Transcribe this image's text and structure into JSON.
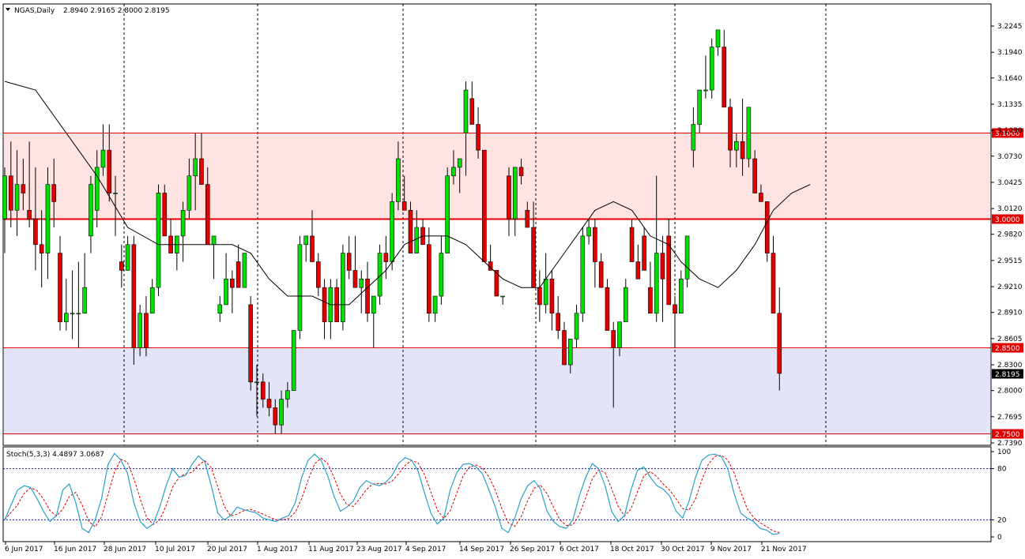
{
  "header": {
    "symbol_text": "NGAS,Daily",
    "ohlc_text": "2.8940 2.9165 2.8000 2.8195"
  },
  "stoch_header": {
    "text": "Stoch(5,3,3) 4.4897 3.0687"
  },
  "colors": {
    "bull": "#00e000",
    "bear": "#e00000",
    "resistance_zone": "#ffe3e3",
    "support_zone": "#e4e4f8",
    "level_line": "#e00000",
    "ma_line": "#000000",
    "stoch_main": "#2aa0c8",
    "stoch_signal": "#e00000",
    "level_marker": "#1010c0"
  },
  "chart_data": {
    "type": "candlestick",
    "y_range": [
      2.739,
      3.2245
    ],
    "price_axis_ticks": [
      "3.2245",
      "3.1940",
      "3.1640",
      "3.1335",
      "3.1030",
      "3.0730",
      "3.0425",
      "3.0120",
      "2.9820",
      "2.9515",
      "2.9210",
      "2.8910",
      "2.8605",
      "2.8300",
      "2.8000",
      "2.7695",
      "2.7390"
    ],
    "x_labels": [
      "6 Jun 2017",
      "16 Jun 2017",
      "28 Jun 2017",
      "10 Jul 2017",
      "20 Jul 2017",
      "1 Aug 2017",
      "11 Aug 2017",
      "23 Aug 2017",
      "4 Sep 2017",
      "14 Sep 2017",
      "26 Sep 2017",
      "6 Oct 2017",
      "18 Oct 2017",
      "30 Oct 2017",
      "9 Nov 2017",
      "21 Nov 2017"
    ],
    "horizontal_levels": [
      {
        "label": "3.1000",
        "value": 3.1
      },
      {
        "label": "3.0000",
        "value": 3.0
      },
      {
        "label": "2.8500",
        "value": 2.85
      },
      {
        "label": "2.7500",
        "value": 2.75
      }
    ],
    "current_price": {
      "label": "2.8195",
      "value": 2.8195
    },
    "zones": [
      {
        "name": "resistance",
        "from": 3.0,
        "to": 3.1
      },
      {
        "name": "support",
        "from": 2.75,
        "to": 2.85
      }
    ],
    "candles": [
      [
        3.0,
        3.06,
        2.96,
        3.05
      ],
      [
        3.05,
        3.09,
        2.99,
        3.01
      ],
      [
        3.01,
        3.08,
        2.98,
        3.04
      ],
      [
        3.04,
        3.07,
        3.01,
        3.03
      ],
      [
        3.01,
        3.09,
        2.99,
        3.0
      ],
      [
        3.0,
        3.06,
        2.94,
        2.97
      ],
      [
        2.97,
        3.01,
        2.92,
        2.96
      ],
      [
        2.96,
        3.06,
        2.93,
        3.04
      ],
      [
        3.04,
        3.07,
        2.99,
        3.02
      ],
      [
        2.96,
        2.98,
        2.87,
        2.88
      ],
      [
        2.88,
        2.93,
        2.87,
        2.89
      ],
      [
        2.89,
        2.94,
        2.86,
        2.89
      ],
      [
        2.89,
        2.95,
        2.85,
        2.89
      ],
      [
        2.89,
        2.96,
        2.89,
        2.92
      ],
      [
        2.98,
        3.05,
        2.96,
        3.04
      ],
      [
        3.01,
        3.08,
        2.99,
        3.06
      ],
      [
        3.06,
        3.11,
        3.05,
        3.08
      ],
      [
        3.08,
        3.11,
        3.02,
        3.03
      ],
      [
        3.03,
        3.05,
        2.98,
        3.03
      ],
      [
        2.95,
        2.97,
        2.92,
        2.94
      ],
      [
        2.94,
        2.98,
        2.94,
        2.97
      ],
      [
        2.97,
        2.98,
        2.83,
        2.85
      ],
      [
        2.85,
        2.9,
        2.84,
        2.89
      ],
      [
        2.89,
        2.91,
        2.84,
        2.85
      ],
      [
        2.89,
        2.93,
        2.89,
        2.92
      ],
      [
        2.92,
        3.04,
        2.91,
        3.03
      ],
      [
        3.03,
        3.04,
        2.98,
        2.98
      ],
      [
        2.98,
        3.0,
        2.97,
        2.96
      ],
      [
        2.96,
        2.98,
        2.94,
        2.98
      ],
      [
        2.98,
        3.02,
        2.95,
        3.01
      ],
      [
        3.01,
        3.07,
        3.0,
        3.05
      ],
      [
        3.05,
        3.1,
        3.01,
        3.07
      ],
      [
        3.07,
        3.1,
        3.04,
        3.04
      ],
      [
        3.04,
        3.06,
        2.97,
        2.97
      ],
      [
        2.97,
        2.98,
        2.93,
        2.98
      ],
      [
        2.89,
        2.91,
        2.88,
        2.9
      ],
      [
        2.9,
        2.96,
        2.9,
        2.93
      ],
      [
        2.93,
        2.94,
        2.89,
        2.92
      ],
      [
        2.95,
        2.97,
        2.92,
        2.92
      ],
      [
        2.92,
        2.96,
        2.92,
        2.96
      ],
      [
        2.9,
        2.91,
        2.8,
        2.81
      ],
      [
        2.81,
        2.83,
        2.77,
        2.81
      ],
      [
        2.81,
        2.82,
        2.78,
        2.79
      ],
      [
        2.79,
        2.81,
        2.77,
        2.78
      ],
      [
        2.78,
        2.79,
        2.75,
        2.76
      ],
      [
        2.76,
        2.8,
        2.75,
        2.79
      ],
      [
        2.79,
        2.81,
        2.78,
        2.8
      ],
      [
        2.8,
        2.84,
        2.8,
        2.87
      ],
      [
        2.87,
        2.98,
        2.86,
        2.97
      ],
      [
        2.97,
        2.98,
        2.95,
        2.98
      ],
      [
        2.98,
        3.01,
        2.95,
        2.95
      ],
      [
        2.95,
        2.96,
        2.91,
        2.92
      ],
      [
        2.92,
        2.93,
        2.86,
        2.88
      ],
      [
        2.88,
        2.93,
        2.86,
        2.92
      ],
      [
        2.92,
        2.93,
        2.88,
        2.88
      ],
      [
        2.88,
        2.97,
        2.87,
        2.96
      ],
      [
        2.96,
        2.98,
        2.93,
        2.94
      ],
      [
        2.94,
        2.98,
        2.92,
        2.92
      ],
      [
        2.92,
        2.94,
        2.89,
        2.93
      ],
      [
        2.93,
        2.95,
        2.88,
        2.89
      ],
      [
        2.89,
        2.91,
        2.85,
        2.91
      ],
      [
        2.91,
        2.97,
        2.9,
        2.96
      ],
      [
        2.96,
        2.98,
        2.93,
        2.95
      ],
      [
        2.95,
        3.03,
        2.94,
        3.02
      ],
      [
        3.02,
        3.09,
        3.01,
        3.07
      ],
      [
        3.02,
        3.05,
        3.01,
        3.01
      ],
      [
        3.01,
        3.02,
        2.96,
        2.96
      ],
      [
        2.96,
        3.01,
        2.96,
        2.99
      ],
      [
        2.99,
        3.0,
        2.97,
        2.97
      ],
      [
        2.97,
        2.99,
        2.88,
        2.89
      ],
      [
        2.89,
        2.91,
        2.88,
        2.91
      ],
      [
        2.91,
        2.98,
        2.9,
        2.96
      ],
      [
        2.96,
        3.06,
        2.96,
        3.05
      ],
      [
        3.05,
        3.08,
        3.04,
        3.06
      ],
      [
        3.06,
        3.07,
        3.03,
        3.07
      ],
      [
        3.1,
        3.16,
        3.05,
        3.15
      ],
      [
        3.14,
        3.16,
        3.11,
        3.11
      ],
      [
        3.11,
        3.13,
        3.07,
        3.08
      ],
      [
        3.08,
        3.08,
        2.95,
        2.95
      ],
      [
        2.95,
        2.97,
        2.94,
        2.94
      ],
      [
        2.94,
        2.94,
        2.91,
        2.91
      ],
      [
        2.91,
        2.91,
        2.9,
        2.91
      ],
      [
        3.05,
        3.06,
        2.98,
        3.0
      ],
      [
        3.0,
        3.06,
        2.98,
        3.06
      ],
      [
        3.06,
        3.07,
        3.04,
        3.05
      ],
      [
        3.01,
        3.02,
        2.99,
        2.99
      ],
      [
        2.99,
        3.02,
        2.96,
        2.92
      ],
      [
        2.92,
        2.94,
        2.88,
        2.9
      ],
      [
        2.9,
        2.96,
        2.89,
        2.93
      ],
      [
        2.93,
        2.94,
        2.87,
        2.89
      ],
      [
        2.89,
        2.91,
        2.86,
        2.87
      ],
      [
        2.87,
        2.88,
        2.84,
        2.83
      ],
      [
        2.83,
        2.85,
        2.82,
        2.86
      ],
      [
        2.86,
        2.9,
        2.85,
        2.89
      ],
      [
        2.89,
        2.99,
        2.88,
        2.98
      ],
      [
        2.98,
        3.0,
        2.97,
        2.99
      ],
      [
        2.99,
        3.0,
        2.92,
        2.95
      ],
      [
        2.95,
        2.96,
        2.92,
        2.92
      ],
      [
        2.92,
        2.93,
        2.87,
        2.87
      ],
      [
        2.87,
        2.88,
        2.78,
        2.85
      ],
      [
        2.85,
        2.88,
        2.84,
        2.88
      ],
      [
        2.88,
        2.93,
        2.88,
        2.92
      ],
      [
        2.99,
        3.0,
        2.95,
        2.95
      ],
      [
        2.95,
        2.97,
        2.93,
        2.93
      ],
      [
        2.98,
        2.99,
        2.94,
        2.94
      ],
      [
        2.92,
        2.95,
        2.89,
        2.89
      ],
      [
        2.89,
        3.05,
        2.88,
        2.96
      ],
      [
        2.96,
        2.98,
        2.88,
        2.93
      ],
      [
        2.98,
        3.0,
        2.9,
        2.9
      ],
      [
        2.9,
        2.91,
        2.85,
        2.89
      ],
      [
        2.89,
        2.94,
        2.89,
        2.93
      ],
      [
        2.93,
        2.98,
        2.92,
        2.98
      ],
      [
        3.08,
        3.13,
        3.06,
        3.11
      ],
      [
        3.11,
        3.14,
        3.1,
        3.15
      ],
      [
        3.15,
        3.19,
        3.14,
        3.15
      ],
      [
        3.15,
        3.21,
        3.14,
        3.2
      ],
      [
        3.2,
        3.22,
        3.19,
        3.22
      ],
      [
        3.2,
        3.22,
        3.13,
        3.13
      ],
      [
        3.13,
        3.14,
        3.06,
        3.08
      ],
      [
        3.08,
        3.1,
        3.06,
        3.09
      ],
      [
        3.09,
        3.14,
        3.05,
        3.07
      ],
      [
        3.07,
        3.13,
        3.06,
        3.13
      ],
      [
        3.07,
        3.08,
        3.03,
        3.03
      ],
      [
        3.03,
        3.04,
        3.02,
        3.02
      ],
      [
        3.02,
        3.02,
        2.95,
        2.96
      ],
      [
        2.96,
        2.98,
        2.89,
        2.89
      ],
      [
        2.89,
        2.92,
        2.8,
        2.82
      ]
    ],
    "moving_average": [
      [
        0,
        3.16
      ],
      [
        5,
        3.15
      ],
      [
        10,
        3.1
      ],
      [
        15,
        3.05
      ],
      [
        20,
        2.99
      ],
      [
        25,
        2.97
      ],
      [
        30,
        2.97
      ],
      [
        33,
        2.97
      ],
      [
        37,
        2.97
      ],
      [
        40,
        2.96
      ],
      [
        43,
        2.93
      ],
      [
        46,
        2.91
      ],
      [
        50,
        2.91
      ],
      [
        53,
        2.9
      ],
      [
        56,
        2.9
      ],
      [
        59,
        2.92
      ],
      [
        62,
        2.94
      ],
      [
        65,
        2.97
      ],
      [
        68,
        2.98
      ],
      [
        72,
        2.98
      ],
      [
        75,
        2.97
      ],
      [
        78,
        2.95
      ],
      [
        81,
        2.93
      ],
      [
        84,
        2.92
      ],
      [
        87,
        2.92
      ],
      [
        90,
        2.95
      ],
      [
        93,
        2.98
      ],
      [
        96,
        3.01
      ],
      [
        99,
        3.02
      ],
      [
        102,
        3.01
      ],
      [
        105,
        2.98
      ],
      [
        108,
        2.97
      ],
      [
        110,
        2.95
      ],
      [
        113,
        2.93
      ],
      [
        116,
        2.92
      ],
      [
        119,
        2.94
      ],
      [
        122,
        2.97
      ],
      [
        125,
        3.01
      ],
      [
        128,
        3.03
      ],
      [
        131,
        3.04
      ]
    ],
    "stochastic": {
      "levels": [
        80,
        20
      ],
      "axis_ticks": [
        "100",
        "80",
        "20",
        "0"
      ],
      "main": [
        20,
        38,
        55,
        60,
        58,
        45,
        30,
        18,
        25,
        55,
        62,
        40,
        10,
        5,
        20,
        45,
        85,
        98,
        90,
        75,
        40,
        18,
        10,
        15,
        35,
        60,
        80,
        70,
        72,
        85,
        95,
        88,
        60,
        28,
        20,
        25,
        35,
        32,
        30,
        28,
        22,
        20,
        18,
        22,
        25,
        40,
        70,
        90,
        97,
        90,
        72,
        48,
        30,
        35,
        42,
        58,
        66,
        62,
        60,
        64,
        72,
        86,
        93,
        90,
        78,
        52,
        28,
        15,
        22,
        55,
        75,
        85,
        86,
        82,
        74,
        55,
        35,
        10,
        5,
        22,
        45,
        60,
        66,
        56,
        30,
        18,
        12,
        10,
        20,
        48,
        70,
        86,
        80,
        60,
        30,
        18,
        25,
        55,
        78,
        82,
        70,
        60,
        56,
        48,
        30,
        22,
        42,
        70,
        90,
        96,
        97,
        94,
        80,
        50,
        28,
        22,
        18,
        10,
        8,
        3,
        4
      ]
    }
  }
}
